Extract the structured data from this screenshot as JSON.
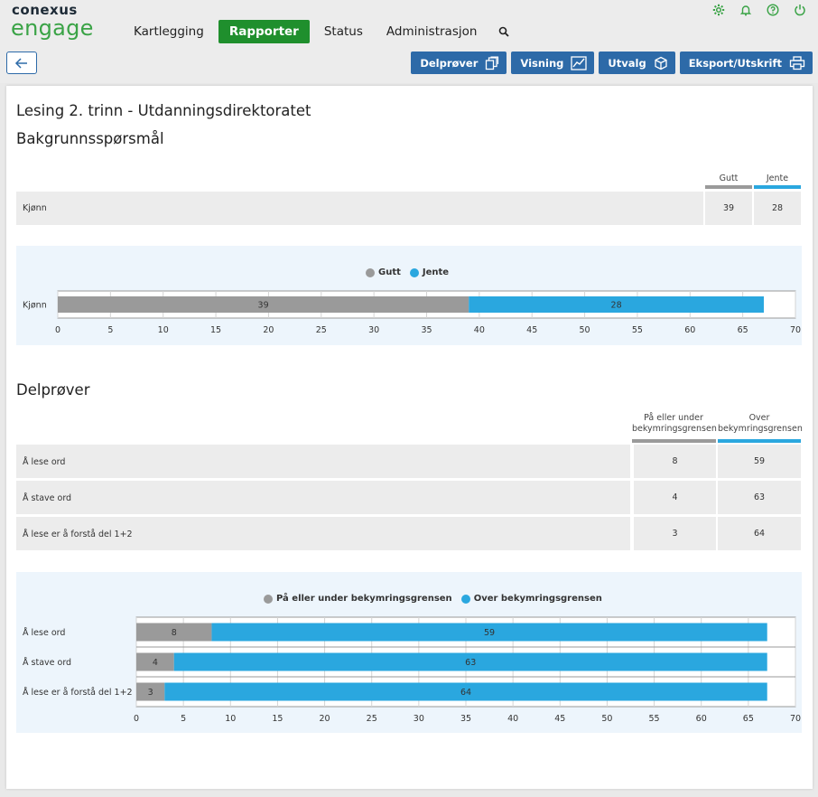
{
  "logo": {
    "top": "conexus",
    "bottom": "engage"
  },
  "nav": {
    "items": [
      "Kartlegging",
      "Rapporter",
      "Status",
      "Administrasjon"
    ],
    "active": "Rapporter"
  },
  "top_icons": [
    "settings-icon",
    "bell-icon",
    "help-icon",
    "power-icon"
  ],
  "actions": [
    "Delprøver",
    "Visning",
    "Utvalg",
    "Eksport/Utskrift"
  ],
  "page": {
    "title": "Lesing 2. trinn - Utdanningsdirektoratet"
  },
  "section1": {
    "title": "Bakgrunnsspørsmål",
    "columns": [
      "Gutt",
      "Jente"
    ],
    "rows": [
      {
        "label": "Kjønn",
        "values": [
          39,
          28
        ]
      }
    ]
  },
  "section2": {
    "title": "Delprøver",
    "columns": [
      "På eller under bekymringsgrensen",
      "Over bekymringsgrensen"
    ],
    "rows": [
      {
        "label": "Å lese ord",
        "values": [
          8,
          59
        ]
      },
      {
        "label": "Å stave ord",
        "values": [
          4,
          63
        ]
      },
      {
        "label": "Å lese er å forstå del 1+2",
        "values": [
          3,
          64
        ]
      }
    ]
  },
  "colors": {
    "gray": "#9a9a9a",
    "blue": "#2aa7df",
    "green": "#1f8f2d",
    "accent": "#2d6aa8"
  },
  "chart_data": [
    {
      "type": "bar",
      "orientation": "horizontal",
      "stacked": true,
      "categories": [
        "Kjønn"
      ],
      "series": [
        {
          "name": "Gutt",
          "values": [
            39
          ]
        },
        {
          "name": "Jente",
          "values": [
            28
          ]
        }
      ],
      "xlim": [
        0,
        70
      ],
      "ticks": [
        0,
        5,
        10,
        15,
        20,
        25,
        30,
        35,
        40,
        45,
        50,
        55,
        60,
        65,
        70
      ],
      "legend": "top-center",
      "grid": true
    },
    {
      "type": "bar",
      "orientation": "horizontal",
      "stacked": true,
      "categories": [
        "Å lese ord",
        "Å stave ord",
        "Å lese er å forstå del 1+2"
      ],
      "series": [
        {
          "name": "På eller under bekymringsgrensen",
          "values": [
            8,
            4,
            3
          ]
        },
        {
          "name": "Over bekymringsgrensen",
          "values": [
            59,
            63,
            64
          ]
        }
      ],
      "xlim": [
        0,
        70
      ],
      "ticks": [
        0,
        5,
        10,
        15,
        20,
        25,
        30,
        35,
        40,
        45,
        50,
        55,
        60,
        65,
        70
      ],
      "legend": "top-center",
      "grid": true
    }
  ]
}
